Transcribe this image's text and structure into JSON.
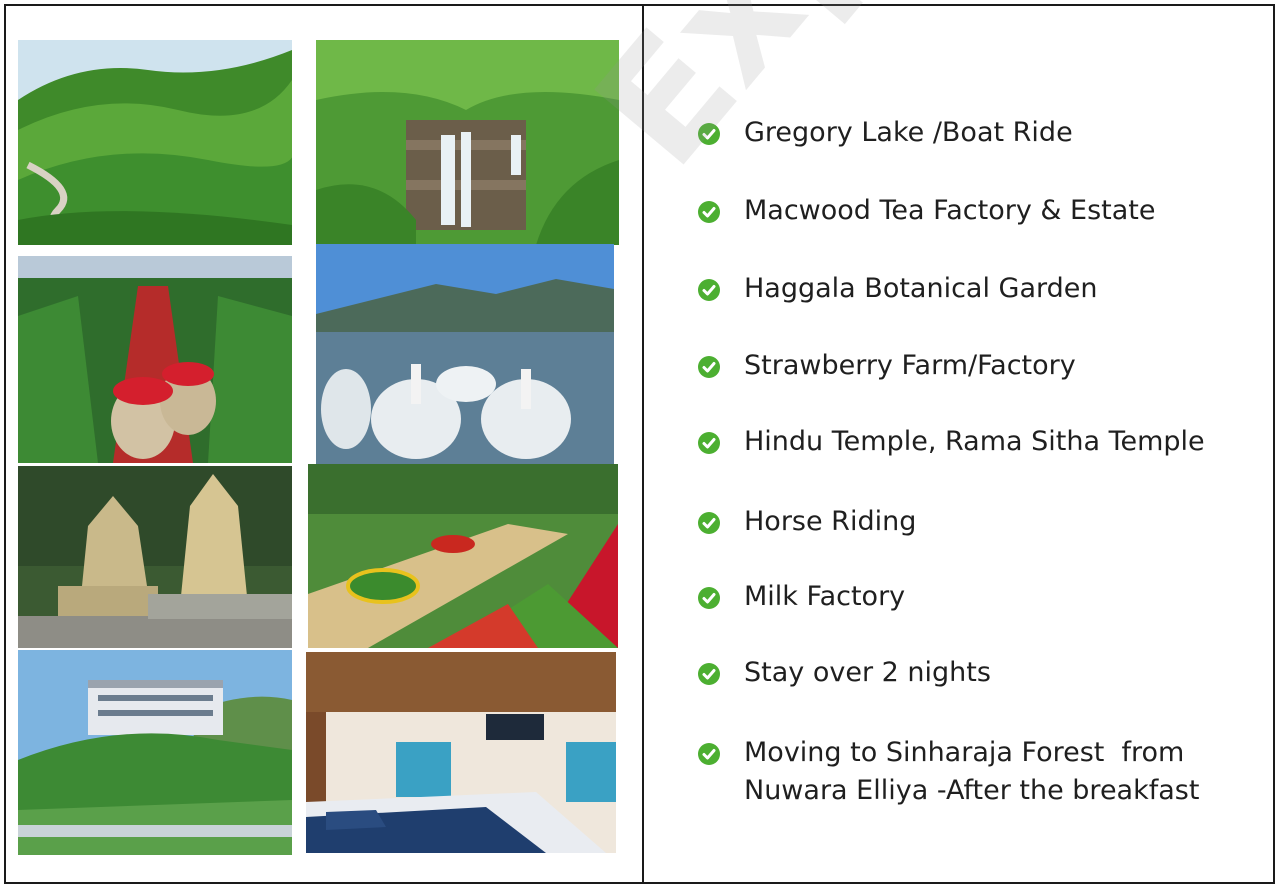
{
  "attractions": [
    "Gregory Lake /Boat Ride",
    "Macwood Tea Factory & Estate",
    "Haggala Botanical Garden",
    "Strawberry Farm/Factory",
    "Hindu Temple, Rama Sitha Temple",
    "Horse Riding",
    "Milk Factory",
    "Stay over 2 nights",
    "Moving to Sinharaja Forest  from\nNuwara Elliya -After the breakfast"
  ],
  "photos": [
    "tea-plantation-hills-photo",
    "waterfall-photo",
    "strawberry-farm-photo",
    "swan-boats-lake-photo",
    "hindu-temple-photo",
    "botanical-garden-photo",
    "tea-factory-building-photo",
    "hotel-bedroom-photo"
  ],
  "watermark": "Explorer Holidays",
  "colors": {
    "check": "#4caf31",
    "text": "#1f1f1f",
    "border": "#1a1a1a"
  }
}
